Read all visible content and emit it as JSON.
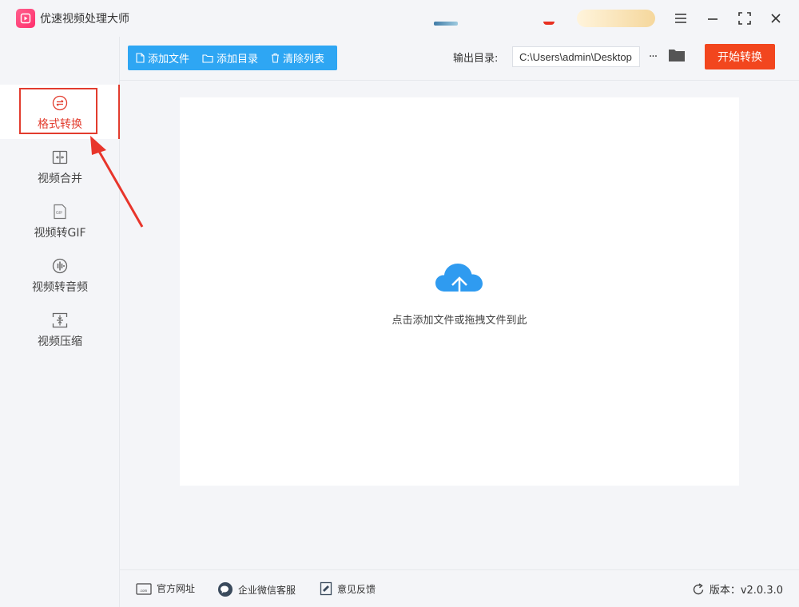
{
  "app": {
    "title": "优速视频处理大师"
  },
  "sidebar": {
    "items": [
      {
        "label": "格式转换",
        "icon": "format-convert-icon",
        "active": true
      },
      {
        "label": "视频合并",
        "icon": "video-merge-icon",
        "active": false
      },
      {
        "label": "视频转GIF",
        "icon": "gif-icon",
        "active": false
      },
      {
        "label": "视频转音频",
        "icon": "audio-icon",
        "active": false
      },
      {
        "label": "视频压缩",
        "icon": "compress-icon",
        "active": false
      }
    ]
  },
  "toolbar": {
    "add_file": "添加文件",
    "add_dir": "添加目录",
    "clear_list": "清除列表",
    "output_label": "输出目录:",
    "output_path": "C:\\Users\\admin\\Desktop",
    "more": "···",
    "start": "开始转换"
  },
  "main": {
    "drop_hint": "点击添加文件或拖拽文件到此"
  },
  "footer": {
    "website": "官方网址",
    "wechat": "企业微信客服",
    "feedback": "意见反馈",
    "version": "版本：v2.0.3.0"
  },
  "colors": {
    "accent_red": "#e23c2e",
    "primary_blue": "#2ea6f3",
    "start_orange": "#f2461e",
    "cloud_blue": "#2f9bf0"
  }
}
